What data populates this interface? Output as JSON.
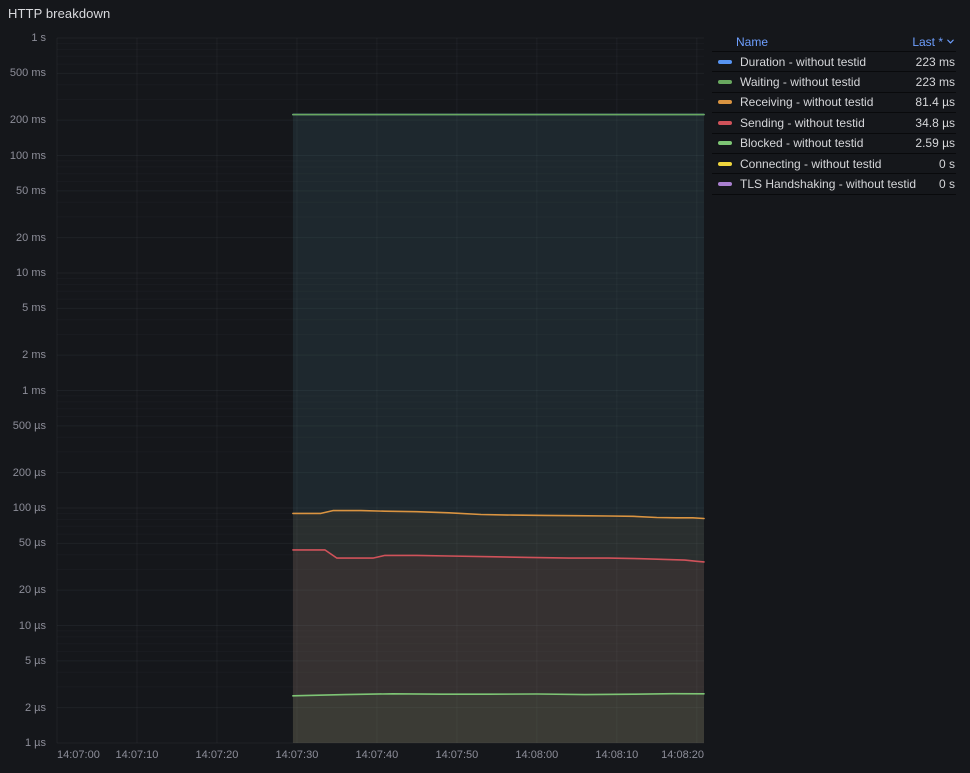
{
  "panel": {
    "title": "HTTP breakdown"
  },
  "legend": {
    "name_header": "Name",
    "value_header": "Last *",
    "sort_icon": "chevron-down-icon"
  },
  "colors": {
    "background": "#15171b",
    "header_link_blue": "#6e9fff",
    "axis_text": "rgba(204,204,220,0.65)"
  },
  "chart_data": {
    "type": "line",
    "title": "HTTP breakdown",
    "grid": true,
    "legend_position": "right-table",
    "y_axis": {
      "scale": "log10",
      "unit": "duration",
      "range_us": [
        1,
        1000000
      ],
      "ticks": [
        {
          "label": "1 s",
          "us": 1000000
        },
        {
          "label": "500 ms",
          "us": 500000
        },
        {
          "label": "200 ms",
          "us": 200000
        },
        {
          "label": "100 ms",
          "us": 100000
        },
        {
          "label": "50 ms",
          "us": 50000
        },
        {
          "label": "20 ms",
          "us": 20000
        },
        {
          "label": "10 ms",
          "us": 10000
        },
        {
          "label": "5 ms",
          "us": 5000
        },
        {
          "label": "2 ms",
          "us": 2000
        },
        {
          "label": "1 ms",
          "us": 1000
        },
        {
          "label": "500 µs",
          "us": 500
        },
        {
          "label": "200 µs",
          "us": 200
        },
        {
          "label": "100 µs",
          "us": 100
        },
        {
          "label": "50 µs",
          "us": 50
        },
        {
          "label": "20 µs",
          "us": 20
        },
        {
          "label": "10 µs",
          "us": 10
        },
        {
          "label": "5 µs",
          "us": 5
        },
        {
          "label": "2 µs",
          "us": 2
        },
        {
          "label": "1 µs",
          "us": 1
        }
      ]
    },
    "x_axis": {
      "range_s": [
        0,
        80.9
      ],
      "ticks": [
        {
          "label": "14:07:00",
          "s": 0
        },
        {
          "label": "14:07:10",
          "s": 10
        },
        {
          "label": "14:07:20",
          "s": 20
        },
        {
          "label": "14:07:30",
          "s": 30
        },
        {
          "label": "14:07:40",
          "s": 40
        },
        {
          "label": "14:07:50",
          "s": 50
        },
        {
          "label": "14:08:00",
          "s": 60
        },
        {
          "label": "14:08:10",
          "s": 70
        },
        {
          "label": "14:08:20",
          "s": 80
        }
      ]
    },
    "fill_opacity": 0.07,
    "series": [
      {
        "name": "Duration - without testid",
        "color": "#5794F2",
        "last": "223 ms",
        "points_us": [
          [
            29.5,
            223500
          ],
          [
            55,
            223500
          ],
          [
            80.9,
            223500
          ]
        ]
      },
      {
        "name": "Waiting - without testid",
        "color": "#69A85F",
        "last": "223 ms",
        "points_us": [
          [
            29.5,
            223000
          ],
          [
            55,
            223000
          ],
          [
            80.9,
            223000
          ]
        ]
      },
      {
        "name": "Receiving - without testid",
        "color": "#DA9441",
        "last": "81.4 µs",
        "points_us": [
          [
            29.5,
            90
          ],
          [
            33,
            90
          ],
          [
            34.5,
            95
          ],
          [
            38,
            95
          ],
          [
            41,
            94
          ],
          [
            45,
            93
          ],
          [
            49,
            91
          ],
          [
            53,
            88
          ],
          [
            57,
            87
          ],
          [
            61,
            86.5
          ],
          [
            65,
            86
          ],
          [
            69,
            85.5
          ],
          [
            72,
            85
          ],
          [
            75,
            83
          ],
          [
            77.5,
            82.5
          ],
          [
            79.5,
            82.5
          ],
          [
            80.9,
            81.4
          ]
        ]
      },
      {
        "name": "Sending - without testid",
        "color": "#D0525A",
        "last": "34.8 µs",
        "points_us": [
          [
            29.5,
            44
          ],
          [
            33.5,
            44
          ],
          [
            35,
            37.5
          ],
          [
            39.5,
            37.5
          ],
          [
            41,
            39.5
          ],
          [
            45,
            39.5
          ],
          [
            49,
            39
          ],
          [
            54,
            38.5
          ],
          [
            59,
            38
          ],
          [
            64,
            37.5
          ],
          [
            69,
            37.5
          ],
          [
            73,
            37
          ],
          [
            76,
            36.5
          ],
          [
            78.5,
            36
          ],
          [
            80,
            35.2
          ],
          [
            80.9,
            34.8
          ]
        ]
      },
      {
        "name": "Blocked - without testid",
        "color": "#7EC575",
        "last": "2.59 µs",
        "points_us": [
          [
            29.5,
            2.52
          ],
          [
            36,
            2.58
          ],
          [
            42,
            2.62
          ],
          [
            48,
            2.6
          ],
          [
            54,
            2.6
          ],
          [
            60,
            2.61
          ],
          [
            66,
            2.58
          ],
          [
            72,
            2.6
          ],
          [
            77,
            2.63
          ],
          [
            80.9,
            2.62
          ]
        ]
      },
      {
        "name": "Connecting - without testid",
        "color": "#EFD53D",
        "last": "0 s",
        "points_us": []
      },
      {
        "name": "TLS Handshaking - without testid",
        "color": "#A97FD0",
        "last": "0 s",
        "points_us": []
      }
    ]
  }
}
